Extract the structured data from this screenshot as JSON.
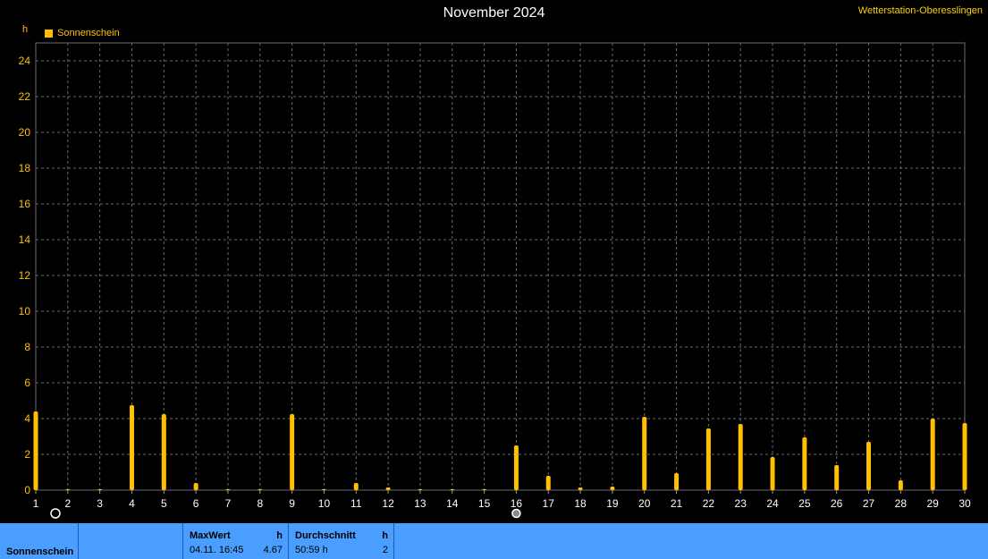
{
  "header": {
    "title": "November 2024",
    "station": "Wetterstation-Oberesslingen",
    "unit": "h"
  },
  "legend": {
    "label": "Sonnenschein",
    "color": "#ffc000"
  },
  "footer": {
    "series_label": "Sonnenschein",
    "max_title": "MaxWert",
    "max_unit": "h",
    "max_date": "04.11.  16:45",
    "max_value": "4.67",
    "avg_title": "Durchschnitt",
    "avg_unit": "h",
    "avg_time": "50:59 h",
    "avg_value": "2"
  },
  "chart_data": {
    "type": "bar",
    "categories": [
      "1",
      "2",
      "3",
      "4",
      "5",
      "6",
      "7",
      "8",
      "9",
      "10",
      "11",
      "12",
      "13",
      "14",
      "15",
      "16",
      "17",
      "18",
      "19",
      "20",
      "21",
      "22",
      "23",
      "24",
      "25",
      "26",
      "27",
      "28",
      "29",
      "30"
    ],
    "series": [
      {
        "name": "Sonnenschein",
        "color": "#ffc000",
        "values": [
          4.4,
          0.05,
          0.05,
          4.75,
          4.25,
          0.4,
          0.05,
          0.05,
          4.25,
          0.05,
          0.4,
          0.15,
          0.05,
          0.05,
          0.05,
          2.5,
          0.8,
          0.15,
          0.2,
          4.1,
          0.95,
          3.45,
          3.7,
          1.85,
          2.95,
          1.4,
          2.7,
          0.55,
          4.0,
          3.75
        ]
      }
    ],
    "ylim": [
      0,
      25
    ],
    "yticks": [
      0,
      2,
      4,
      6,
      8,
      10,
      12,
      14,
      16,
      18,
      20,
      22,
      24
    ],
    "grid": true,
    "moon_phase_days": [
      {
        "day": "1",
        "symbol": "new-moon"
      },
      {
        "day": "16",
        "symbol": "full-moon"
      }
    ]
  }
}
